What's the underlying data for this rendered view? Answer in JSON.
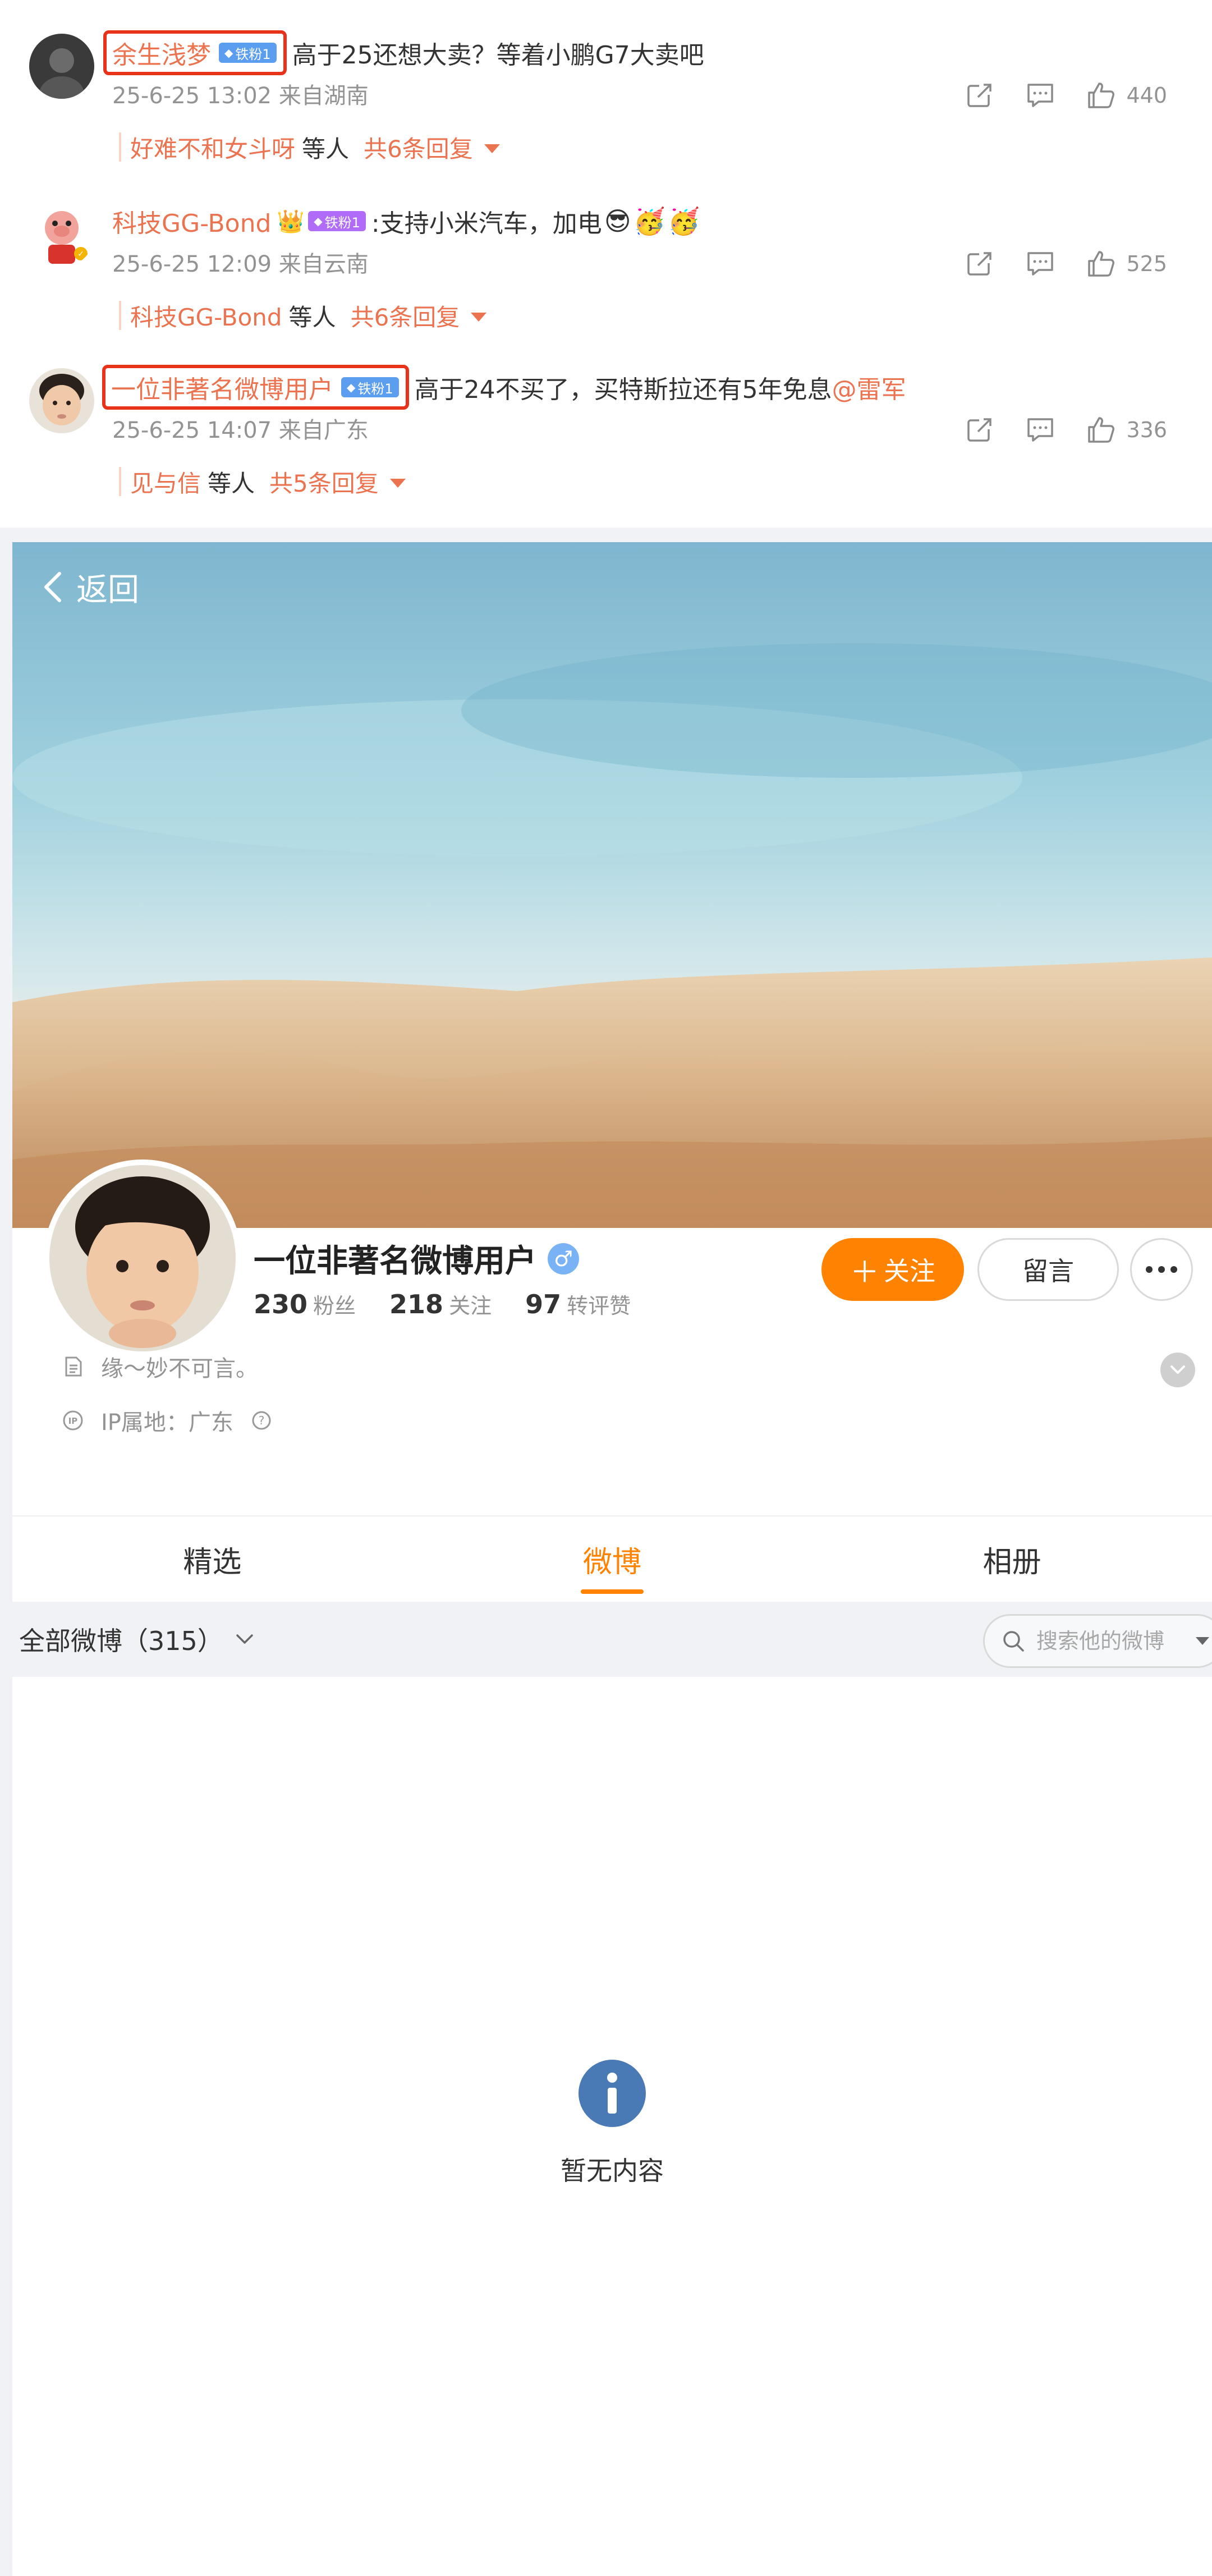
{
  "comments": [
    {
      "username": "余生浅梦",
      "badge": "铁粉1",
      "text": "高于25还想大卖？等着小鹏G7大卖吧",
      "mention": "",
      "meta": "25-6-25 13:02 来自湖南",
      "likes": "440",
      "reply_names": "好难不和女斗呀",
      "reply_etc": "等人",
      "reply_count": "共6条回复"
    },
    {
      "username": "科技GG-Bond",
      "badge": "铁粉1",
      "text": ":支持小米汽车，加电",
      "mention": "",
      "meta": "25-6-25 12:09 来自云南",
      "likes": "525",
      "reply_names": "科技GG-Bond",
      "reply_etc": "等人",
      "reply_count": "共6条回复"
    },
    {
      "username": "一位非著名微博用户",
      "badge": "铁粉1",
      "text": "高于24不买了，买特斯拉还有5年免息",
      "mention": "@雷军",
      "meta": "25-6-25 14:07 来自广东",
      "likes": "336",
      "reply_names": "见与信",
      "reply_etc": "等人",
      "reply_count": "共5条回复"
    }
  ],
  "profile": {
    "back_label": "返回",
    "name": "一位非著名微博用户",
    "gender_symbol": "♂",
    "stats": [
      {
        "num": "230",
        "label": "粉丝"
      },
      {
        "num": "218",
        "label": "关注"
      },
      {
        "num": "97",
        "label": "转评赞"
      }
    ],
    "follow_label": "关注",
    "message_label": "留言",
    "bio": "缘～妙不可言。",
    "ip": "IP属地：广东",
    "tabs": [
      "精选",
      "微博",
      "相册"
    ],
    "active_tab": "微博"
  },
  "filter": {
    "all_posts": "全部微博（315）",
    "search_placeholder": "搜索他的微博"
  },
  "empty_text": "暂无内容",
  "colors": {
    "accent": "#ff8200",
    "link": "#eb7350",
    "highlight_box": "#e8331a"
  }
}
